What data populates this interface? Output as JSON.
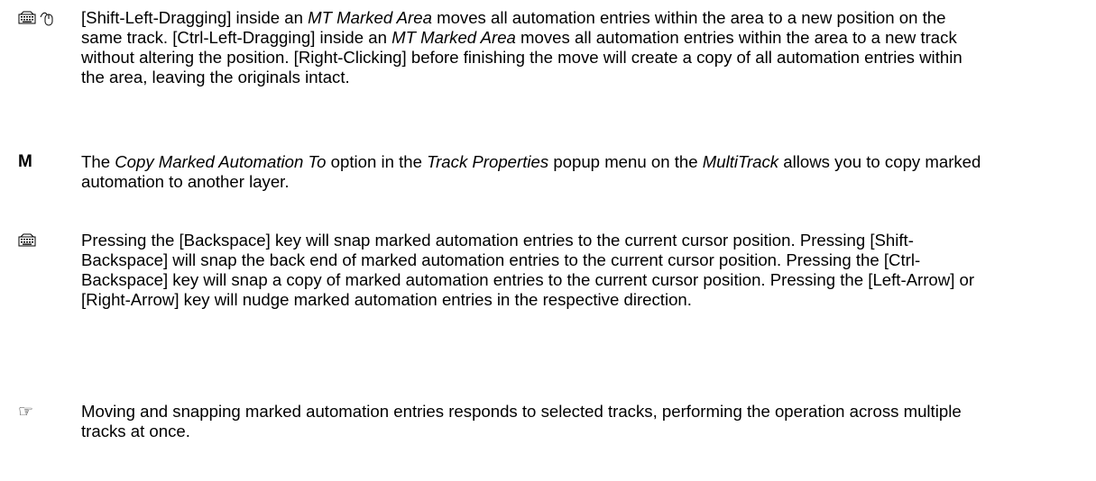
{
  "entries": [
    {
      "marker": "keyboard-mouse",
      "parts": [
        {
          "t": "[Shift-Left-Dragging] inside an "
        },
        {
          "t": "MT Marked Area",
          "i": true
        },
        {
          "t": " moves all automation entries within the area to a new position on the same track. [Ctrl-Left-Dragging] inside an "
        },
        {
          "t": "MT Marked Area",
          "i": true
        },
        {
          "t": " moves all automation entries within the area to a new track without altering the position. [Right-Clicking] before finishing the move will create a copy of all automation entries within the area, leaving the originals intact."
        }
      ]
    },
    {
      "marker": "M",
      "parts": [
        {
          "t": "The "
        },
        {
          "t": "Copy Marked Automation To",
          "i": true
        },
        {
          "t": " option in the "
        },
        {
          "t": "Track Properties",
          "i": true
        },
        {
          "t": " popup menu on the "
        },
        {
          "t": "MultiTrack",
          "i": true
        },
        {
          "t": " allows you to copy marked automation to another layer."
        }
      ]
    },
    {
      "marker": "keyboard",
      "parts": [
        {
          "t": "Pressing the [Backspace] key will snap marked automation entries to the current cursor position. Pressing [Shift-Backspace] will snap the back end of marked automation entries to the current cursor position. Pressing the [Ctrl-Backspace] key will snap a copy of marked automation entries to the current cursor position. Pressing the [Left-Arrow] or [Right-Arrow] key will nudge marked automation entries in the respective direction."
        }
      ]
    },
    {
      "marker": "pointing-hand",
      "parts": [
        {
          "t": "Moving and snapping marked automation entries responds to selected tracks, performing the operation across multiple tracks at once."
        }
      ]
    }
  ],
  "marker_m_text": "M",
  "marker_hand_glyph": "☞"
}
